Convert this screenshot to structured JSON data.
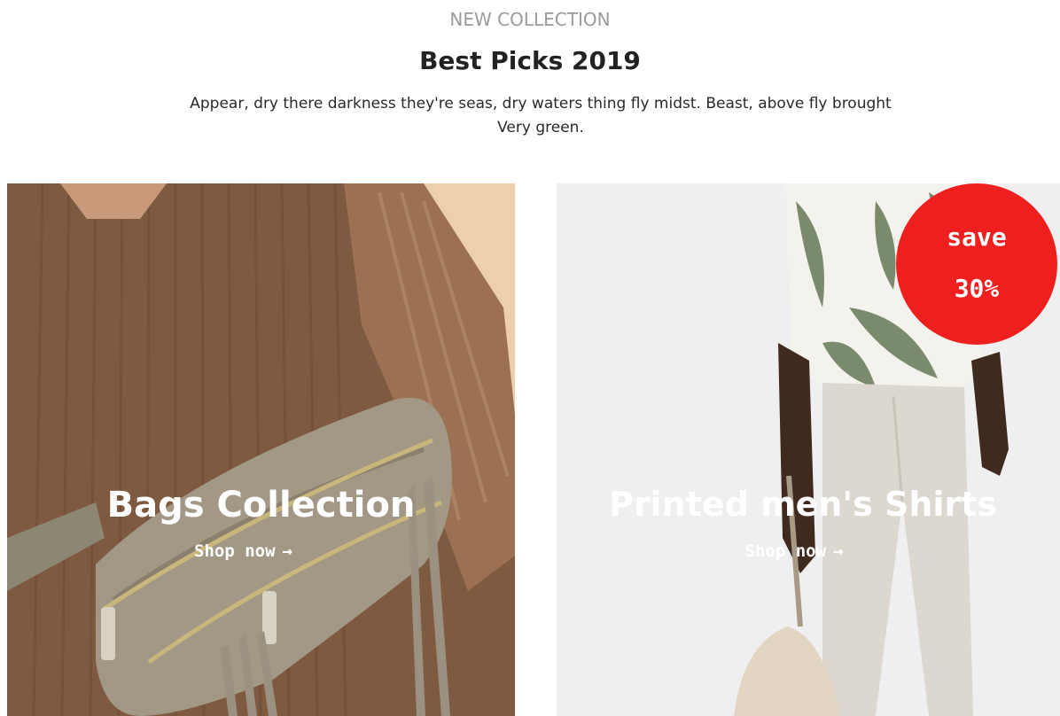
{
  "section": {
    "eyebrow": "NEW COLLECTION",
    "title": "Best Picks 2019",
    "description": "Appear, dry there darkness they're seas, dry waters thing fly midst. Beast, above fly brought Very green."
  },
  "cards": [
    {
      "title": "Bags Collection",
      "cta": "Shop now",
      "cta_icon": "arrow-right-icon",
      "image": "brown-ribbed-top-with-suede-fringe-belt-bag"
    },
    {
      "title": "Printed men's Shirts",
      "cta": "Shop now",
      "cta_icon": "arrow-right-icon",
      "image": "man-in-leaf-print-shirt-and-linen-trousers",
      "badge": {
        "line1": "save",
        "line2": "30%"
      }
    }
  ],
  "colors": {
    "eyebrow": "#9b9b9b",
    "title": "#222222",
    "badge": "#ee1f1f"
  }
}
